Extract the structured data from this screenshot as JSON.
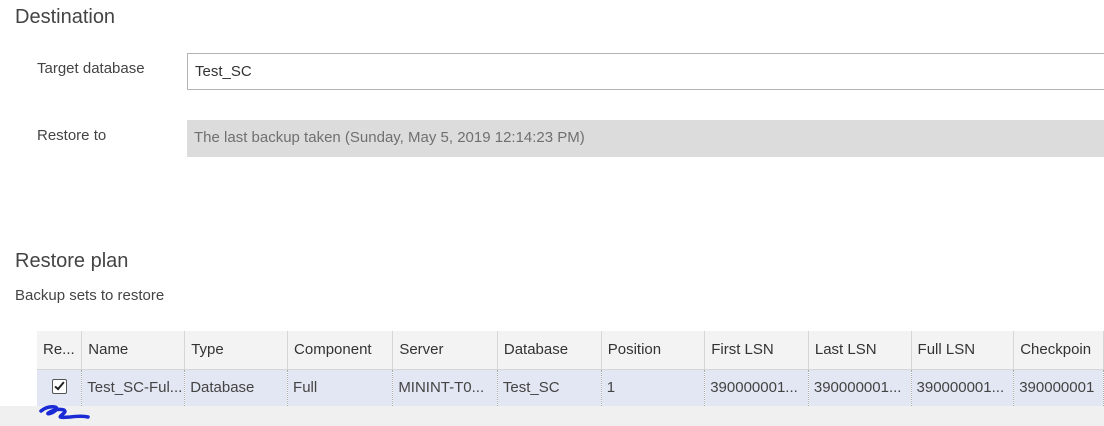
{
  "destination": {
    "title": "Destination",
    "target_database": {
      "label": "Target database",
      "value": "Test_SC"
    },
    "restore_to": {
      "label": "Restore to",
      "value": "The last backup taken (Sunday, May 5, 2019 12:14:23 PM)"
    }
  },
  "restore_plan": {
    "title": "Restore plan",
    "subtitle": "Backup sets to restore",
    "columns": [
      "Re...",
      "Name",
      "Type",
      "Component",
      "Server",
      "Database",
      "Position",
      "First LSN",
      "Last LSN",
      "Full LSN",
      "Checkpoin"
    ],
    "rows": [
      {
        "restore_checked": true,
        "name": "Test_SC-Ful...",
        "type": "Database",
        "component": "Full",
        "server": "MININT-T0...",
        "database": "Test_SC",
        "position": "1",
        "first_lsn": "390000001...",
        "last_lsn": "390000001...",
        "full_lsn": "390000001...",
        "checkpoint_lsn": "390000001"
      }
    ]
  },
  "colors": {
    "selected_row": "#e3e7f3",
    "header_bg": "#f3f3f3",
    "readonly_bg": "#dcdcdc",
    "annotation_scribble": "#1a2bd6"
  },
  "icons": {
    "row_checkbox": "checkbox-checked-icon",
    "annotation": "pen-scribble-mark"
  }
}
